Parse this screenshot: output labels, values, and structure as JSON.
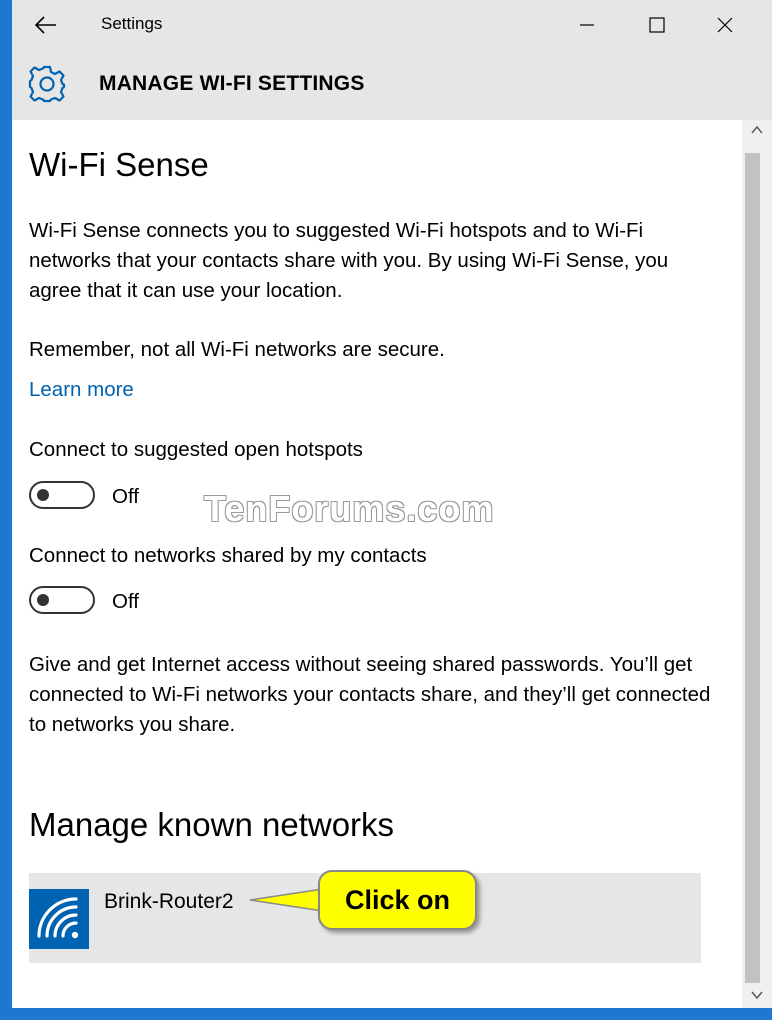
{
  "window": {
    "title": "Settings",
    "header_title": "MANAGE WI-FI SETTINGS"
  },
  "wifi_sense": {
    "heading": "Wi-Fi Sense",
    "description": "Wi-Fi Sense connects you to suggested Wi-Fi hotspots and to Wi-Fi networks that your contacts share with you. By using Wi-Fi Sense, you agree that it can use your location.",
    "remember": "Remember, not all Wi-Fi networks are secure.",
    "learn_more": "Learn more",
    "toggle_open_hotspots": {
      "label": "Connect to suggested open hotspots",
      "state": "Off"
    },
    "toggle_contacts": {
      "label": "Connect to networks shared by my contacts",
      "state": "Off"
    },
    "give_get": "Give and get Internet access without seeing shared passwords. You’ll get connected to Wi-Fi networks your contacts share, and they’ll get connected to networks you share."
  },
  "known_networks": {
    "heading": "Manage known networks",
    "items": [
      {
        "name": "Brink-Router2",
        "icon": "wifi-icon"
      }
    ]
  },
  "callout": {
    "text": "Click on"
  },
  "watermark": {
    "text": "TenForums.com"
  },
  "colors": {
    "accent": "#0063b1",
    "chrome": "#e6e6e6",
    "frame": "#1e78d2",
    "callout": "#ffff00"
  }
}
